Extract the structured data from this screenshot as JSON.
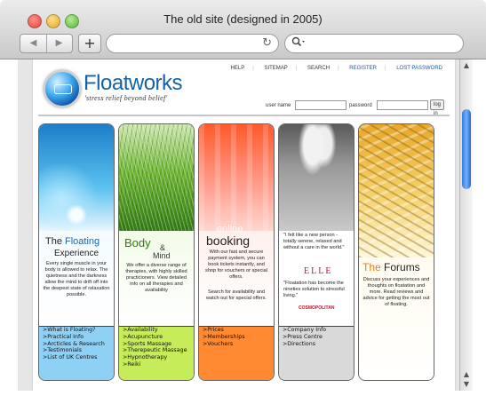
{
  "window": {
    "title": "The old site (designed in 2005)"
  },
  "toolbar": {
    "back": "◀",
    "forward": "▶",
    "add": "+",
    "reload": "↻",
    "search_icon": "magnifier-icon"
  },
  "site": {
    "logo": "Floatworks",
    "tagline": "'stress relief beyond belief'",
    "top_links": [
      "HELP",
      "SITEMAP",
      "SEARCH",
      "REGISTER",
      "LOST PASSWORD"
    ],
    "login": {
      "user_label": "user name",
      "password_label": "password",
      "button": "log in"
    }
  },
  "panels": [
    {
      "heading_pre": "The ",
      "heading_main": "Floating",
      "heading_sub": "Experience",
      "text": "Every single muscle in your body is allowed to relax. The quietness and the darkness allow the mind to drift off into the deepest state of relaxation possible.",
      "links": [
        ">What is Floating?",
        ">Practical Info",
        ">Arcticles & Research",
        ">Testimonials",
        ">List of UK Centres"
      ],
      "link_bg": "#8fd0f5"
    },
    {
      "heading_pre": "Body",
      "heading_main": "&",
      "heading_sub": "Mind",
      "text": "We offer a diverse range of therapies, with highly skilled practicioners. View detailed info on all therapies and availability",
      "links": [
        ">Availability",
        ">Acupuncture",
        ">Sports Massage",
        ">Therepeutic Massage",
        ">Hypnotherapy",
        ">Reiki"
      ],
      "link_bg": "#c6ec5a"
    },
    {
      "overlay": "online",
      "heading_main": "booking",
      "text": "With our fast and secure payment system, you can book tickets instantly, and shop for vouchers or special offers.",
      "text2": "Search for availability and watch out for special offers.",
      "links": [
        ">Prices",
        ">Memberships",
        ">Vouchers"
      ],
      "link_bg": "#ff8a32"
    },
    {
      "quote1": "\"I felt like a new person - totally serene, relaxed and without a care in the world.\"",
      "brand1": "ELLE",
      "quote2": "\"Floatation has become the nineties solution to stressful living.\"",
      "brand2": "COSMOPOLITAN",
      "links": [
        ">Company Info",
        ">Press Centre",
        ">Directions"
      ],
      "link_bg": "#d9d9d9"
    },
    {
      "heading_pre": "The ",
      "heading_main": "Forums",
      "text": "Discuss your experiences and thoughts on floatation and more. Read reviews and advice for getting the most out of floating.",
      "links": [],
      "link_bg": "#ffe27a"
    }
  ]
}
